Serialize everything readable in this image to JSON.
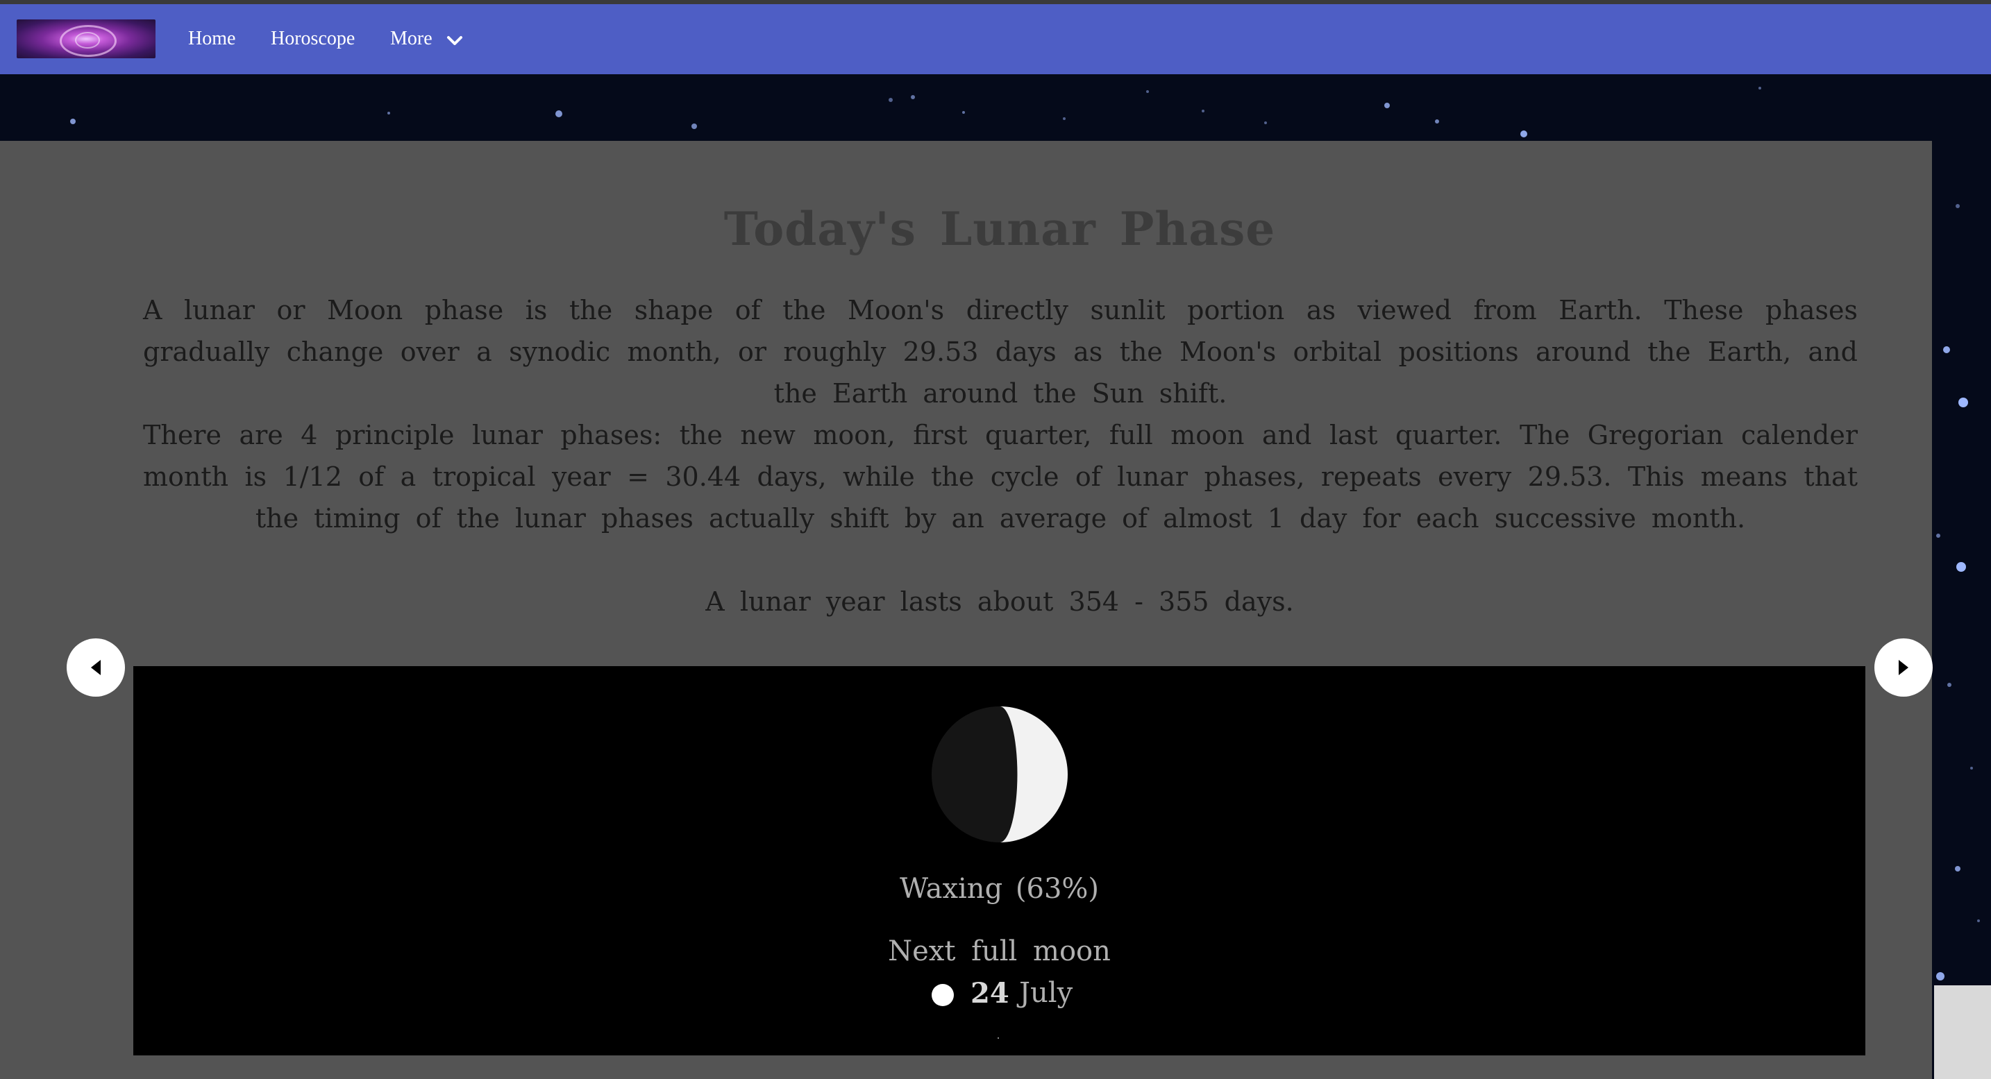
{
  "navbar": {
    "logo_alt": "site-logo",
    "links": [
      {
        "label": "Home"
      },
      {
        "label": "Horoscope"
      },
      {
        "label": "More"
      }
    ]
  },
  "main": {
    "title": "Today's Lunar Phase",
    "paragraph1": "A lunar or Moon phase is the shape of the Moon's directly sunlit portion as viewed from Earth. These phases gradually change over a synodic month, or roughly 29.53 days as the Moon's orbital positions around the Earth, and the Earth around the Sun shift.",
    "paragraph2": "There are 4 principle lunar phases: the new moon, first quarter, full moon and last quarter. The Gregorian calender month is 1/12 of a tropical year = 30.44 days, while the cycle of lunar phases, repeats every 29.53. This means that the timing of the lunar phases actually shift by an average of almost 1 day for each successive month.",
    "paragraph3": "A lunar year lasts about 354 - 355 days."
  },
  "moon": {
    "phase_label": "Waxing (63%)",
    "illumination": 0.63,
    "next_label": "Next full moon",
    "next_day": "24",
    "next_month": "July"
  },
  "colors": {
    "navbar": "#4e5ec5",
    "panel": "#545454",
    "moon_box": "#000000",
    "moon_lit": "#f2f2f2",
    "moon_dark": "#151515"
  },
  "icons": {
    "prev": "caret-left-icon",
    "next": "caret-right-icon",
    "more": "chevron-down-icon",
    "full_moon": "full-moon-dot-icon"
  }
}
